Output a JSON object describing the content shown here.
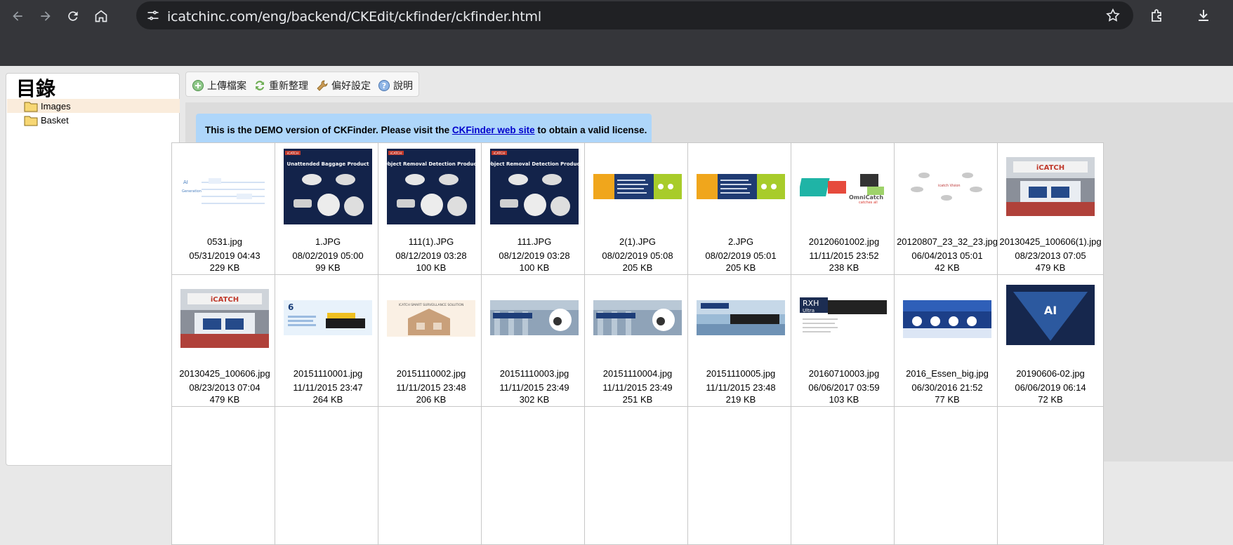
{
  "browser": {
    "url": "icatchinc.com/eng/backend/CKEdit/ckfinder/ckfinder.html",
    "icons": [
      "back-icon",
      "forward-icon",
      "reload-icon",
      "home-icon",
      "site-info-icon",
      "bookmark-star-icon",
      "extensions-icon",
      "downloads-icon"
    ]
  },
  "sidebar": {
    "title": "目錄",
    "folders": [
      {
        "label": "Images",
        "selected": true
      },
      {
        "label": "Basket",
        "selected": false
      }
    ]
  },
  "toolbar": {
    "upload": "上傳檔案",
    "refresh": "重新整理",
    "settings": "偏好設定",
    "help": "說明"
  },
  "notice": {
    "prefix": "This is the DEMO version of CKFinder. Please visit the ",
    "link": "CKFinder web site",
    "suffix": " to obtain a valid license."
  },
  "files": [
    {
      "name": "0531.jpg",
      "date": "05/31/2019 04:43",
      "size": "229 KB",
      "kind": "diagram"
    },
    {
      "name": "1.JPG",
      "date": "08/02/2019 05:00",
      "size": "99 KB",
      "kind": "navy-product",
      "caption": "Unattended Baggage Product",
      "brand": "iCATCH"
    },
    {
      "name": "111(1).JPG",
      "date": "08/12/2019 03:28",
      "size": "100 KB",
      "kind": "navy-product",
      "caption": "Object Removal Detection Product",
      "brand": "iCATCH"
    },
    {
      "name": "111.JPG",
      "date": "08/12/2019 03:28",
      "size": "100 KB",
      "kind": "navy-product",
      "caption": "Object Removal Detection Product",
      "brand": "iCATCH"
    },
    {
      "name": "2(1).JPG",
      "date": "08/02/2019 05:08",
      "size": "205 KB",
      "kind": "banner-color"
    },
    {
      "name": "2.JPG",
      "date": "08/02/2019 05:01",
      "size": "205 KB",
      "kind": "banner-color"
    },
    {
      "name": "20120601002.jpg",
      "date": "11/11/2015 23:52",
      "size": "238 KB",
      "kind": "omnicatch",
      "caption": "OmniCatch",
      "sub": "catches all"
    },
    {
      "name": "20120807_23_32_23.jpg",
      "date": "06/04/2013 05:01",
      "size": "42 KB",
      "kind": "icons-white"
    },
    {
      "name": "20130425_100606(1).jpg",
      "date": "08/23/2013 07:05",
      "size": "479 KB",
      "kind": "booth"
    },
    {
      "name": "20130425_100606.jpg",
      "date": "08/23/2013 07:04",
      "size": "479 KB",
      "kind": "booth"
    },
    {
      "name": "20151110001.jpg",
      "date": "11/11/2015 23:47",
      "size": "264 KB",
      "kind": "nvr-banner"
    },
    {
      "name": "20151110002.jpg",
      "date": "11/11/2015 23:48",
      "size": "206 KB",
      "kind": "house"
    },
    {
      "name": "20151110003.jpg",
      "date": "11/11/2015 23:49",
      "size": "302 KB",
      "kind": "camera-banner"
    },
    {
      "name": "20151110004.jpg",
      "date": "11/11/2015 23:49",
      "size": "251 KB",
      "kind": "camera-banner"
    },
    {
      "name": "20151110005.jpg",
      "date": "11/11/2015 23:48",
      "size": "219 KB",
      "kind": "nvr-blue"
    },
    {
      "name": "20160710003.jpg",
      "date": "06/06/2017 03:59",
      "size": "103 KB",
      "kind": "rxh",
      "caption": "RXH",
      "sub": "Ultra"
    },
    {
      "name": "2016_Essen_big.jpg",
      "date": "06/30/2016 21:52",
      "size": "77 KB",
      "kind": "essen"
    },
    {
      "name": "20190606-02.jpg",
      "date": "06/06/2019 06:14",
      "size": "72 KB",
      "kind": "ai",
      "caption": "AI"
    }
  ]
}
